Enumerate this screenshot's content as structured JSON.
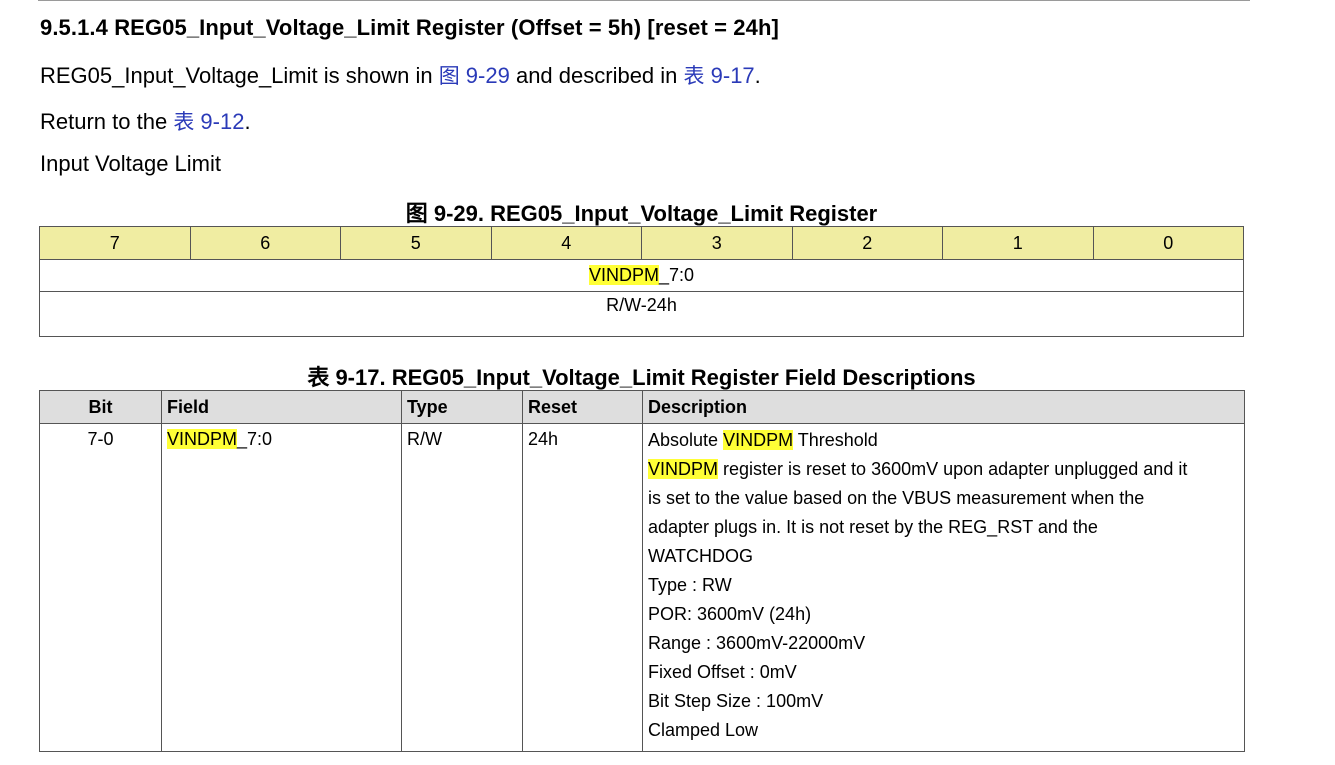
{
  "section": {
    "heading": "9.5.1.4 REG05_Input_Voltage_Limit Register (Offset = 5h) [reset = 24h]",
    "intro": {
      "prefix": "REG05_Input_Voltage_Limit is shown in ",
      "figure_ref_cjk": "图",
      "figure_ref_num": " 9-29",
      "middle": " and described in ",
      "table_ref_cjk": "表",
      "table_ref_num": " 9-17",
      "suffix": "."
    },
    "return_line": {
      "prefix": "Return to the ",
      "table_ref_cjk": "表",
      "table_ref_num": " 9-12",
      "suffix": "."
    },
    "summary": "Input Voltage Limit"
  },
  "figure": {
    "caption": "图 9-29. REG05_Input_Voltage_Limit Register",
    "bits": [
      "7",
      "6",
      "5",
      "4",
      "3",
      "2",
      "1",
      "0"
    ],
    "field_highlight": "VINDPM",
    "field_rest": "_7:0",
    "access": "R/W-24h"
  },
  "field_table": {
    "caption": "表 9-17. REG05_Input_Voltage_Limit Register Field Descriptions",
    "headers": [
      "Bit",
      "Field",
      "Type",
      "Reset",
      "Description"
    ],
    "row": {
      "bit": "7-0",
      "field_highlight": "VINDPM",
      "field_rest": "_7:0",
      "type": "R/W",
      "reset": "24h",
      "description": {
        "line1_prefix": "Absolute ",
        "line1_highlight": "VINDPM",
        "line1_suffix": " Threshold",
        "line2_highlight": "VINDPM",
        "line2_rest": " register is reset to 3600mV upon adapter unplugged and it",
        "line3": "is set to the value based on the VBUS measurement when the",
        "line4": "adapter plugs in. It is not reset by the REG_RST and the",
        "line5": "WATCHDOG",
        "line6": "Type : RW",
        "line7": "POR: 3600mV (24h)",
        "line8": "Range : 3600mV-22000mV",
        "line9": "Fixed Offset : 0mV",
        "line10": "Bit Step Size : 100mV",
        "line11": "Clamped Low"
      }
    }
  },
  "colors": {
    "link": "#2a3ab8",
    "highlight": "#ffff36",
    "bit_header_bg": "#f0eda2",
    "table_header_bg": "#dedede"
  }
}
